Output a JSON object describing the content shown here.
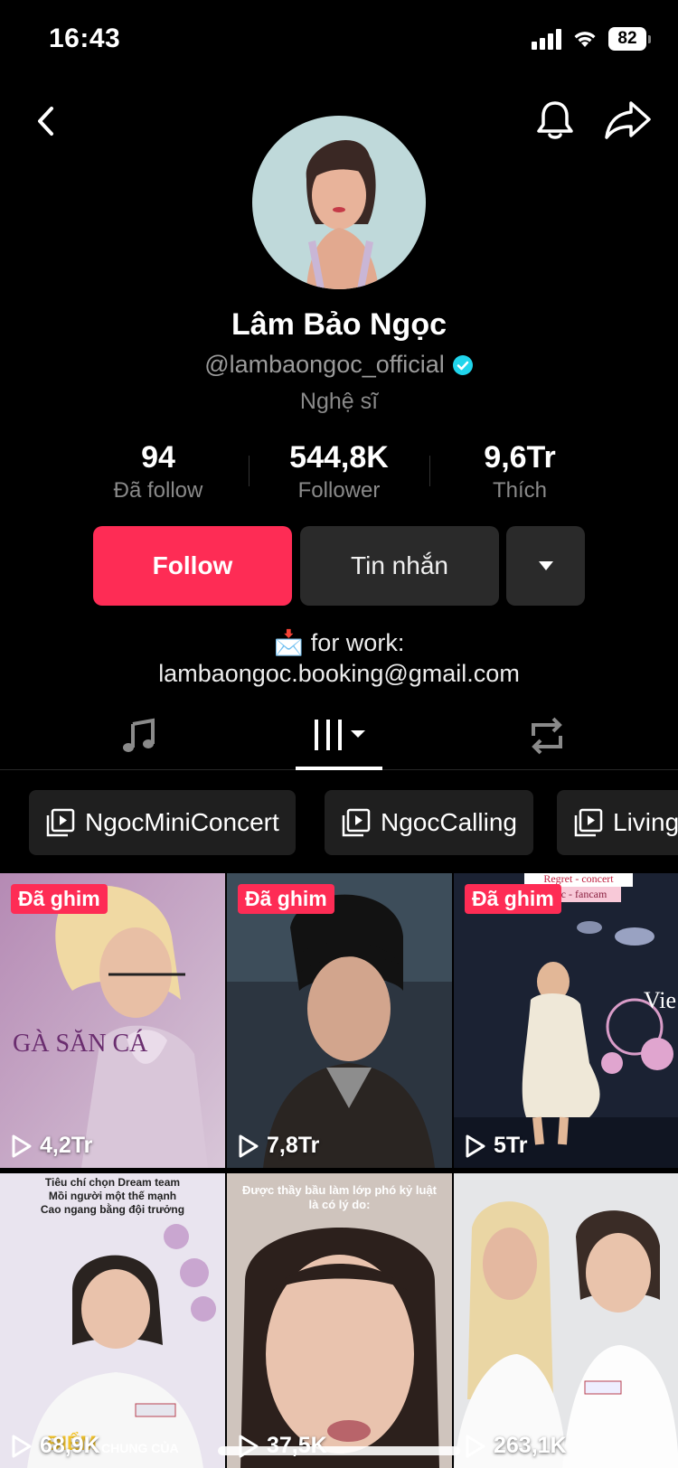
{
  "status_bar": {
    "time": "16:43",
    "battery": "82"
  },
  "profile": {
    "name": "Lâm Bảo Ngọc",
    "handle": "@lambaongoc_official",
    "category": "Nghệ sĩ"
  },
  "stats": [
    {
      "value": "94",
      "label": "Đã follow"
    },
    {
      "value": "544,8K",
      "label": "Follower"
    },
    {
      "value": "9,6Tr",
      "label": "Thích"
    }
  ],
  "actions": {
    "follow": "Follow",
    "message": "Tin nhắn"
  },
  "bio": {
    "line1_emoji": "📩",
    "line1_text": "for work:",
    "line2": "lambaongoc.booking@gmail.com"
  },
  "playlists": [
    "NgocMiniConcert",
    "NgocCalling",
    "Living"
  ],
  "videos": [
    {
      "views": "4,2Tr",
      "pinned": "Đã ghim",
      "overlay_text": "GÀ SĂN CÁ"
    },
    {
      "views": "7,8Tr",
      "pinned": "Đã ghim"
    },
    {
      "views": "5Tr",
      "pinned": "Đã ghim",
      "overlay_text": "Regret - concert",
      "overlay_text2": "ngoc - fancam",
      "overlay_text3": "Vie"
    },
    {
      "views": "68,9K",
      "overlay_text": "Tiêu chí chọn Dream team",
      "overlay_text2": "Mồi người một thế mạnh",
      "overlay_text3": "Cao ngang bằng đội trưởng",
      "overlay_text4": "ĐIỂM",
      "overlay_text5": "CHUNG CỦA"
    },
    {
      "views": "37,5K",
      "overlay_text": "Được thầy bầu làm lớp phó kỷ luật",
      "overlay_text2": "là có lý do:"
    },
    {
      "views": "263,1K"
    }
  ],
  "colors": {
    "accent": "#fe2c55",
    "verified": "#20d5ec",
    "button_dark": "#2a2a2a"
  }
}
